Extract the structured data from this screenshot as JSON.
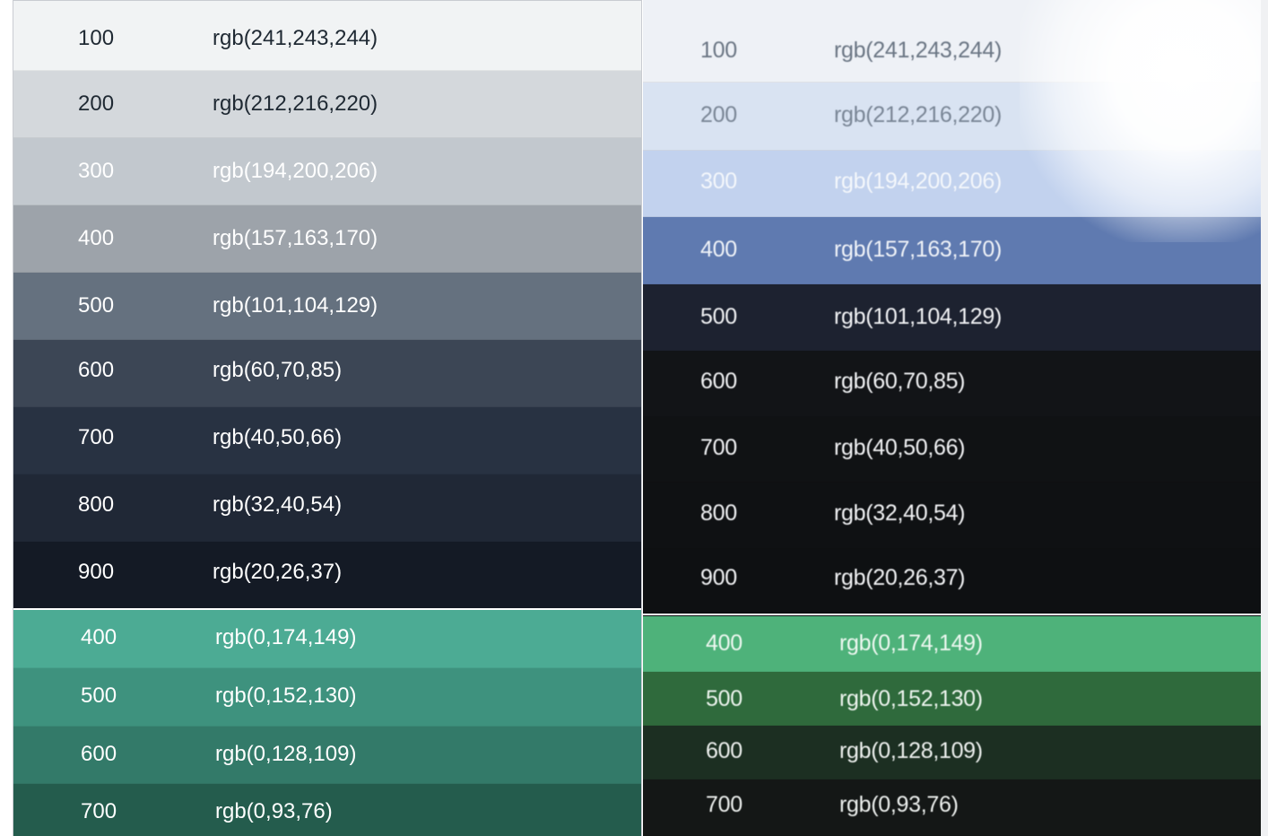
{
  "left_panel": {
    "gray_rows": [
      {
        "step": "100",
        "value": "rgb(241,243,244)",
        "bg": "#f1f3f4",
        "fg": "#1f2933"
      },
      {
        "step": "200",
        "value": "rgb(212,216,220)",
        "bg": "#d4d8dc",
        "fg": "#1f2933"
      },
      {
        "step": "300",
        "value": "rgb(194,200,206)",
        "bg": "#c2c8ce",
        "fg": "#ffffff"
      },
      {
        "step": "400",
        "value": "rgb(157,163,170)",
        "bg": "#9da3aa",
        "fg": "#ffffff"
      },
      {
        "step": "500",
        "value": "rgb(101,104,129)",
        "bg": "#65717f",
        "fg": "#ffffff"
      },
      {
        "step": "600",
        "value": "rgb(60,70,85)",
        "bg": "#3c4655",
        "fg": "#ffffff"
      },
      {
        "step": "700",
        "value": "rgb(40,50,66)",
        "bg": "#283242",
        "fg": "#ffffff"
      },
      {
        "step": "800",
        "value": "rgb(32,40,54)",
        "bg": "#202836",
        "fg": "#ffffff"
      },
      {
        "step": "900",
        "value": "rgb(20,26,37)",
        "bg": "#141a25",
        "fg": "#ffffff"
      }
    ],
    "green_rows": [
      {
        "step": "400",
        "value": "rgb(0,174,149)",
        "bg": "#4cab94",
        "fg": "#ffffff"
      },
      {
        "step": "500",
        "value": "rgb(0,152,130)",
        "bg": "#3e927e",
        "fg": "#ffffff"
      },
      {
        "step": "600",
        "value": "rgb(0,128,109)",
        "bg": "#337a69",
        "fg": "#ffffff"
      },
      {
        "step": "700",
        "value": "rgb(0,93,76)",
        "bg": "#245c4d",
        "fg": "#ffffff"
      }
    ]
  },
  "right_panel": {
    "gray_rows": [
      {
        "step": "100",
        "value": "rgb(241,243,244)",
        "bg": "#eef1f6",
        "fg": "#6b7684"
      },
      {
        "step": "200",
        "value": "rgb(212,216,220)",
        "bg": "#d9e3f2",
        "fg": "#7a8696"
      },
      {
        "step": "300",
        "value": "rgb(194,200,206)",
        "bg": "#c2d2ee",
        "fg": "#f4f7fb"
      },
      {
        "step": "400",
        "value": "rgb(157,163,170)",
        "bg": "#5f7ab0",
        "fg": "#f0f3f8"
      },
      {
        "step": "500",
        "value": "rgb(101,104,129)",
        "bg": "#1d2230",
        "fg": "#f2f3f5"
      },
      {
        "step": "600",
        "value": "rgb(60,70,85)",
        "bg": "#121417",
        "fg": "#f2f3f5"
      },
      {
        "step": "700",
        "value": "rgb(40,50,66)",
        "bg": "#101214",
        "fg": "#f2f3f5"
      },
      {
        "step": "800",
        "value": "rgb(32,40,54)",
        "bg": "#0f1113",
        "fg": "#f2f3f5"
      },
      {
        "step": "900",
        "value": "rgb(20,26,37)",
        "bg": "#0e1012",
        "fg": "#f2f3f5"
      }
    ],
    "green_rows": [
      {
        "step": "400",
        "value": "rgb(0,174,149)",
        "bg": "#4eb27a",
        "fg": "#eef8f1"
      },
      {
        "step": "500",
        "value": "rgb(0,152,130)",
        "bg": "#2f6a3c",
        "fg": "#eef5ef"
      },
      {
        "step": "600",
        "value": "rgb(0,128,109)",
        "bg": "#1c2f22",
        "fg": "#eef1ef"
      },
      {
        "step": "700",
        "value": "rgb(0,93,76)",
        "bg": "#141716",
        "fg": "#eef1ef"
      }
    ]
  }
}
